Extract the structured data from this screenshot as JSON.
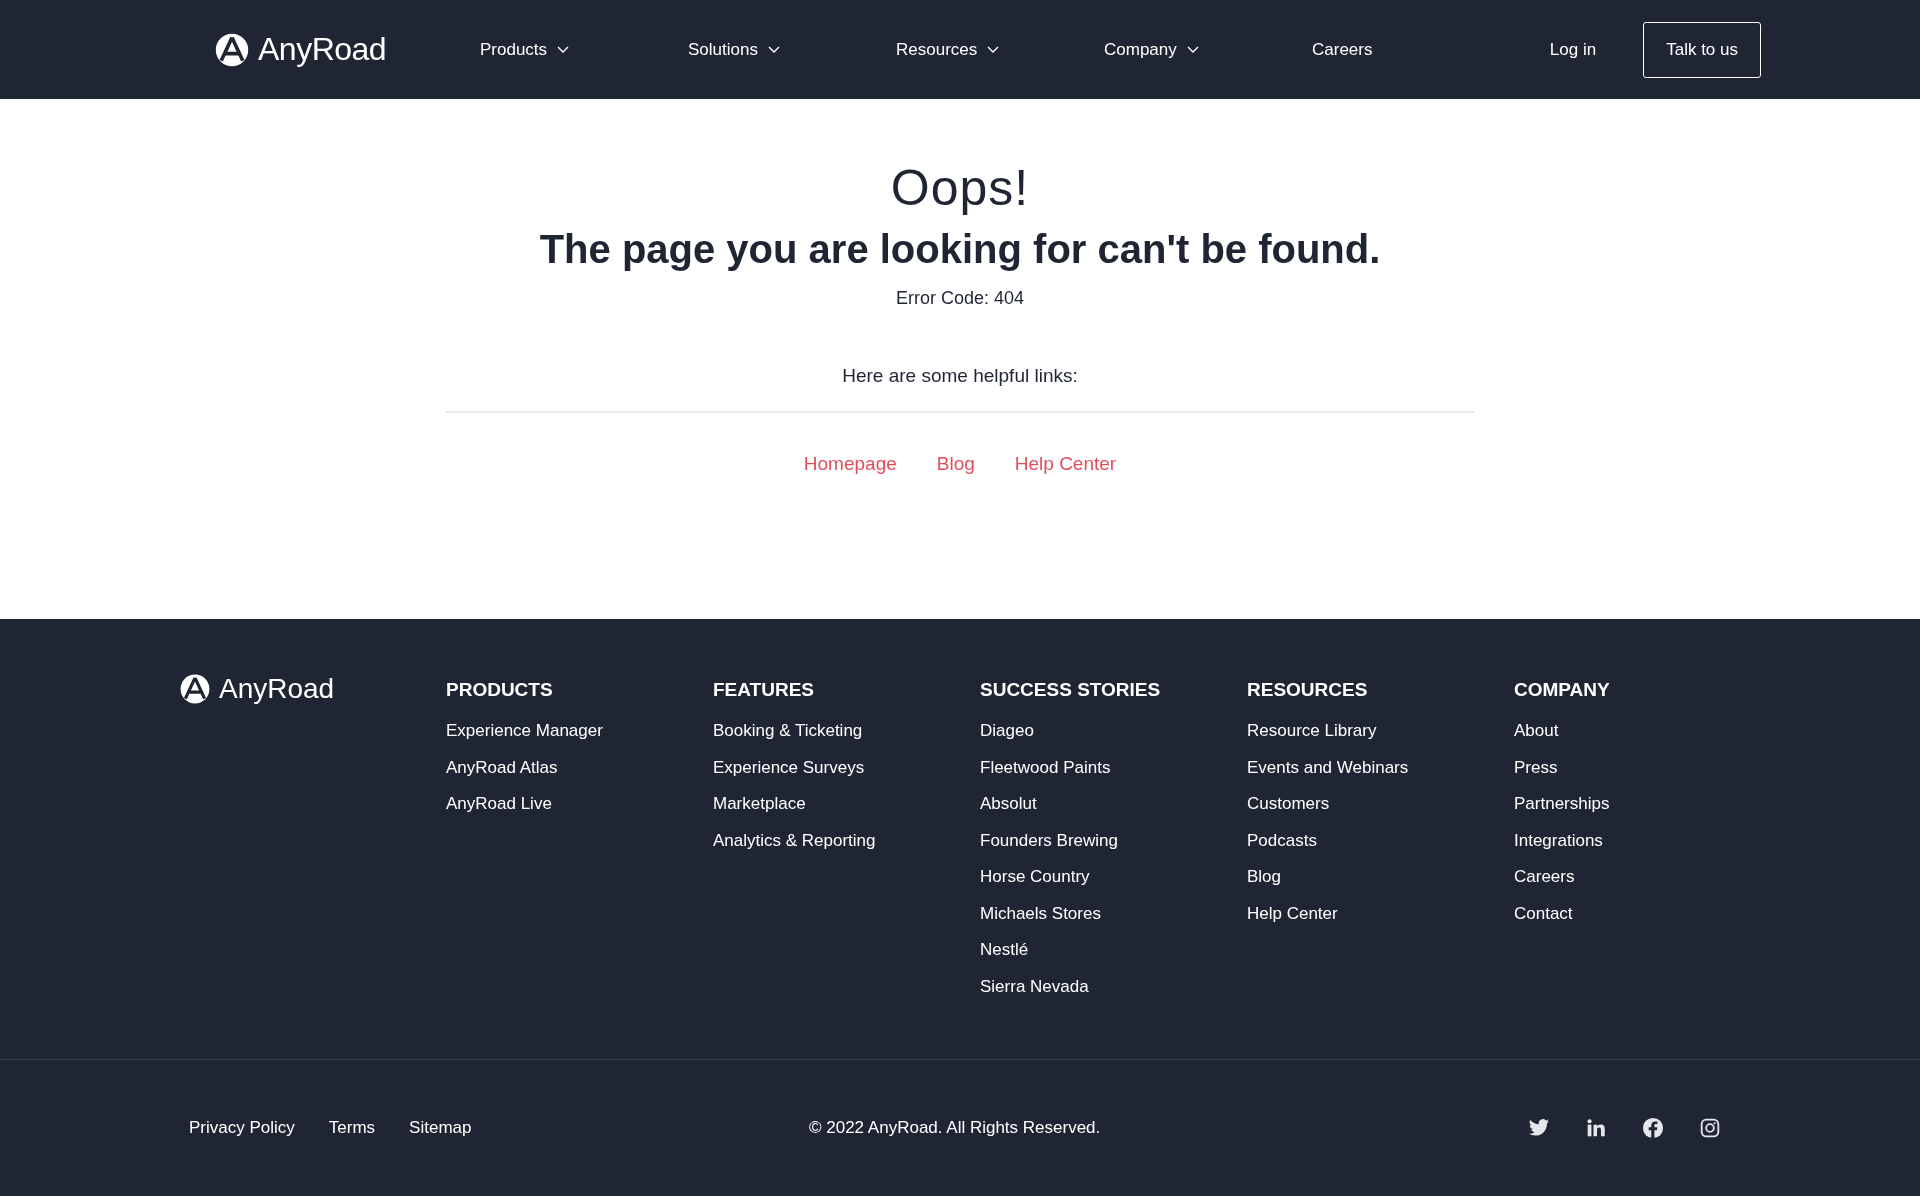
{
  "nav": {
    "logo": "AnyRoad",
    "items": [
      {
        "label": "Products",
        "dropdown": true
      },
      {
        "label": "Solutions",
        "dropdown": true
      },
      {
        "label": "Resources",
        "dropdown": true
      },
      {
        "label": "Company",
        "dropdown": true
      },
      {
        "label": "Careers",
        "dropdown": false
      }
    ],
    "login": "Log in",
    "cta": "Talk to us"
  },
  "error": {
    "title": "Oops!",
    "heading": "The page you are looking for can't be found.",
    "code": "Error Code: 404",
    "links_intro": "Here are some helpful links:",
    "links": [
      "Homepage",
      "Blog",
      "Help Center"
    ]
  },
  "footer": {
    "logo": "AnyRoad",
    "columns": [
      {
        "title": "PRODUCTS",
        "links": [
          "Experience Manager",
          "AnyRoad Atlas",
          "AnyRoad Live"
        ]
      },
      {
        "title": "FEATURES",
        "links": [
          "Booking & Ticketing",
          "Experience Surveys",
          "Marketplace",
          "Analytics & Reporting"
        ]
      },
      {
        "title": "SUCCESS STORIES",
        "links": [
          "Diageo",
          "Fleetwood Paints",
          "Absolut",
          "Founders Brewing",
          "Horse Country",
          "Michaels Stores",
          "Nestlé",
          "Sierra Nevada"
        ]
      },
      {
        "title": "RESOURCES",
        "links": [
          "Resource Library",
          "Events and Webinars",
          "Customers",
          "Podcasts",
          "Blog",
          "Help Center"
        ]
      },
      {
        "title": "COMPANY",
        "links": [
          "About",
          "Press",
          "Partnerships",
          "Integrations",
          "Careers",
          "Contact"
        ]
      }
    ],
    "legal_links": [
      "Privacy Policy",
      "Terms",
      "Sitemap"
    ],
    "copyright": "© 2022 AnyRoad. All Rights Reserved.",
    "social": [
      {
        "kind": "twitter"
      },
      {
        "kind": "linkedin"
      },
      {
        "kind": "facebook"
      },
      {
        "kind": "instagram"
      }
    ]
  }
}
